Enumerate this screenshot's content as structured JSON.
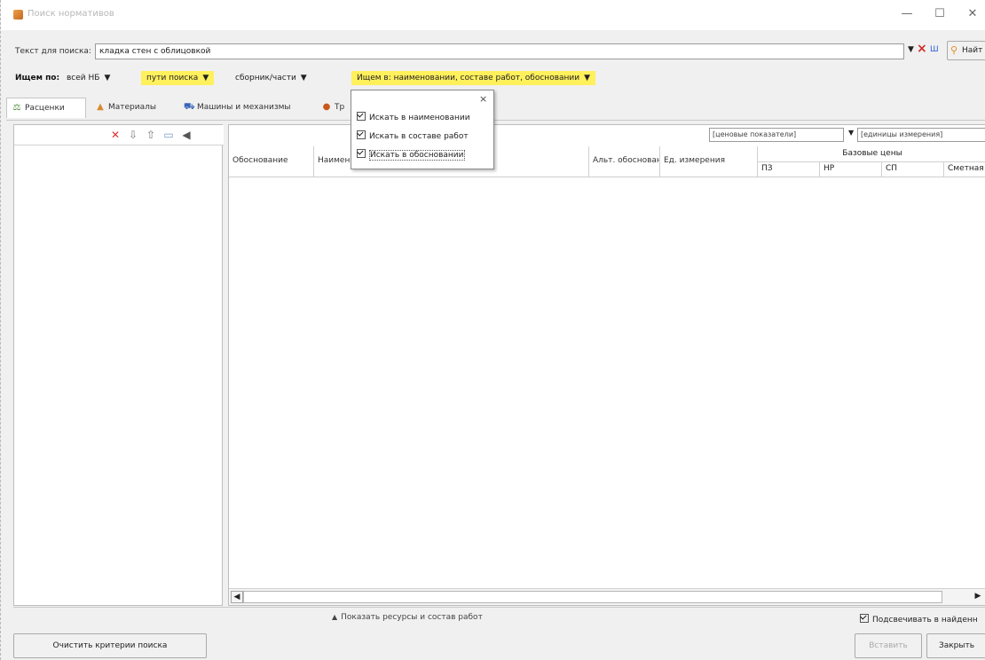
{
  "window": {
    "title": "Поиск нормативов",
    "controls": [
      "—",
      "☐",
      "✕"
    ]
  },
  "search": {
    "label": "Текст для поиска:",
    "value": "кладка стен с облицовкой",
    "find_label": "Найт",
    "clear_icon": "×",
    "mode_icon": "Ш"
  },
  "filters": {
    "label": "Ищем по:",
    "base": "всей НБ",
    "paths": "пути поиска",
    "collection": "сборник/части",
    "search_in": "Ищем в: наименовании, составе работ, обосновании"
  },
  "tabs": [
    {
      "label": "Расценки"
    },
    {
      "label": "Материалы"
    },
    {
      "label": "Машины и механизмы"
    },
    {
      "label": "Тр"
    }
  ],
  "popup": {
    "close": "×",
    "items": [
      {
        "label": "Искать в наименовании",
        "checked": true
      },
      {
        "label": "Искать в составе работ",
        "checked": true
      },
      {
        "label": "Искать в обосновании",
        "checked": true
      }
    ]
  },
  "grid": {
    "combo1": "[ценовые показатели]",
    "combo2": "[единицы измерения]",
    "headers": [
      "Обоснование",
      "Наимен",
      "Альт. обоснование",
      "Ед. измерения",
      "Базовые цены"
    ],
    "subheaders": [
      "ПЗ",
      "НР",
      "СП",
      "Сметная"
    ]
  },
  "bottom": {
    "show_resources": "Показать ресурсы и состав работ",
    "highlight": "Подсвечивать в найденн",
    "clear_criteria": "Очистить критерии поиска",
    "insert": "Вставить",
    "close": "Закрыть"
  },
  "colors": {
    "accent_yellow": "#fff05c",
    "window_bg": "#f0f0f0"
  }
}
